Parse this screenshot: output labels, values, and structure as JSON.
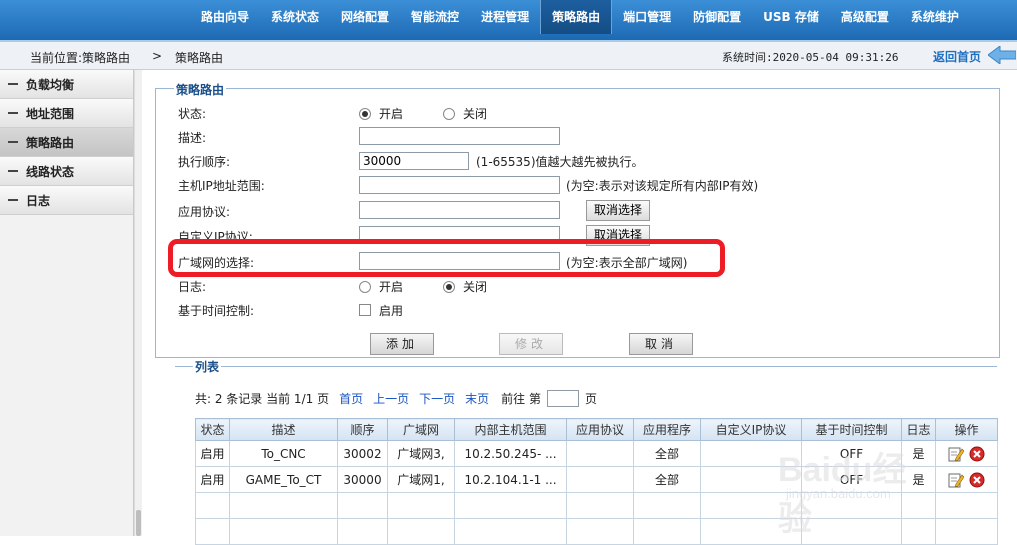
{
  "nav": {
    "items": [
      "路由向导",
      "系统状态",
      "网络配置",
      "智能流控",
      "进程管理",
      "策略路由",
      "端口管理",
      "防御配置",
      "USB 存储",
      "高级配置",
      "系统维护"
    ],
    "active_index": 5
  },
  "crumb": {
    "location_label": "当前位置:策略路由",
    "separator": ">",
    "current": "策略路由",
    "system_time": "系统时间:2020-05-04 09:31:26",
    "home_link": "返回首页"
  },
  "sidebar": {
    "items": [
      "负载均衡",
      "地址范围",
      "策略路由",
      "线路状态",
      "日志"
    ],
    "active_index": 2
  },
  "form": {
    "legend": "策略路由",
    "status_label": "状态:",
    "status_on": "开启",
    "status_off": "关闭",
    "desc_label": "描述:",
    "desc_value": "",
    "order_label": "执行顺序:",
    "order_value": "30000",
    "order_hint": "(1-65535)值越大越先被执行。",
    "host_ip_label": "主机IP地址范围:",
    "host_ip_value": "",
    "host_ip_hint": "(为空:表示对该规定所有内部IP有效)",
    "app_proto_label": "应用协议:",
    "app_proto_value": "",
    "cancel_select": "取消选择",
    "custom_ip_label": "自定义IP协议:",
    "custom_ip_value": "",
    "wan_label": "广域网的选择:",
    "wan_value": "",
    "wan_hint": "(为空:表示全部广域网)",
    "log_label": "日志:",
    "log_on": "开启",
    "log_off": "关闭",
    "time_ctrl_label": "基于时间控制:",
    "time_ctrl_enable": "启用",
    "add_btn": "添加",
    "modify_btn": "修改",
    "cancel_btn": "取消"
  },
  "list": {
    "legend": "列表",
    "summary": "共: 2 条记录 当前 1/1 页",
    "first": "首页",
    "prev": "上一页",
    "next": "下一页",
    "last": "末页",
    "goto_label": "前往 第",
    "page_unit": "页",
    "headers": [
      "状态",
      "描述",
      "顺序",
      "广域网",
      "内部主机范围",
      "应用协议",
      "应用程序",
      "自定义IP协议",
      "基于时间控制",
      "日志",
      "操作"
    ],
    "rows": [
      [
        "启用",
        "To_CNC",
        "30002",
        "广域网3,",
        "10.2.50.245- ...",
        "",
        "全部",
        "",
        "OFF",
        "是",
        ""
      ],
      [
        "启用",
        "GAME_To_CT",
        "30000",
        "广域网1,",
        "10.2.104.1-1 ...",
        "",
        "全部",
        "",
        "OFF",
        "是",
        ""
      ]
    ]
  },
  "watermark": {
    "brand": "Baidu经验",
    "url": "jingyan.baidu.com"
  },
  "colors": {
    "nav_blue": "#2a7ccb",
    "highlight_red": "#ee1c25",
    "link_blue": "#1a55c4"
  }
}
